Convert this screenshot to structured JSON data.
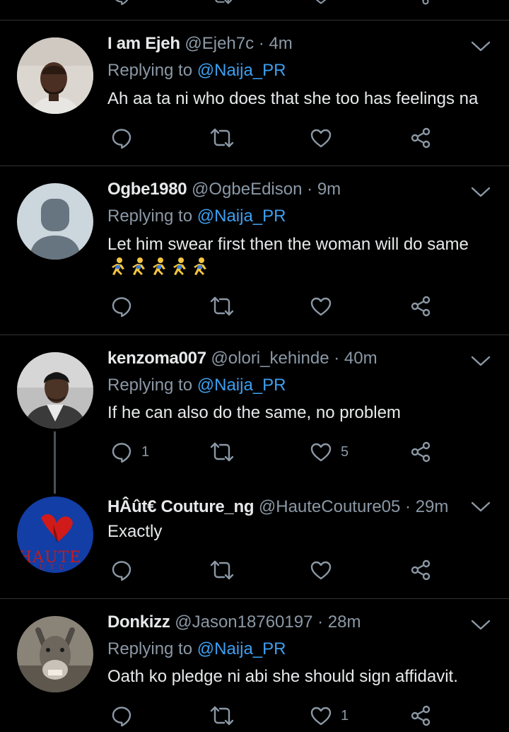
{
  "tweets": [
    {
      "name": "I am Ejeh",
      "handle": "@Ejeh7c",
      "sep": "·",
      "time": "4m",
      "replying_prefix": "Replying to ",
      "replying_to": "@Naija_PR",
      "text": "Ah aa ta ni who does that she too has feelings na",
      "reply_count": "",
      "like_count": ""
    },
    {
      "name": "Ogbe1980",
      "handle": "@OgbeEdison",
      "sep": "·",
      "time": "9m",
      "replying_prefix": "Replying to ",
      "replying_to": "@Naija_PR",
      "text": "Let him swear first then the woman will do same",
      "emoji": "🏃🏃🏃🏃🏃",
      "reply_count": "",
      "like_count": ""
    },
    {
      "name": "kenzoma007",
      "handle": "@olori_kehinde",
      "sep": "·",
      "time": "40m",
      "replying_prefix": "Replying to ",
      "replying_to": "@Naija_PR",
      "text": "If he can also do the same, no problem",
      "reply_count": "1",
      "like_count": "5"
    },
    {
      "name": "HÂût€ Couture_ng",
      "handle": "@HauteCouture05",
      "sep": "·",
      "time": "29m",
      "text": "Exactly",
      "avatar_text": "HAUTE",
      "avatar_subtext": "U T U",
      "reply_count": "",
      "like_count": ""
    },
    {
      "name": "Donkizz",
      "handle": "@Jason18760197",
      "sep": "·",
      "time": "28m",
      "replying_prefix": "Replying to ",
      "replying_to": "@Naija_PR",
      "text": "Oath ko pledge ni abi she should sign affidavit.",
      "reply_count": "",
      "like_count": "1"
    }
  ],
  "icons": {
    "reply": "reply-icon",
    "retweet": "retweet-icon",
    "like": "heart-icon",
    "share": "share-icon",
    "more": "chevron-down-icon"
  },
  "colors": {
    "background": "#000000",
    "text": "#e7e9ea",
    "muted": "#8b98a5",
    "mention": "#3d9ff0",
    "divider": "#2f3336"
  }
}
